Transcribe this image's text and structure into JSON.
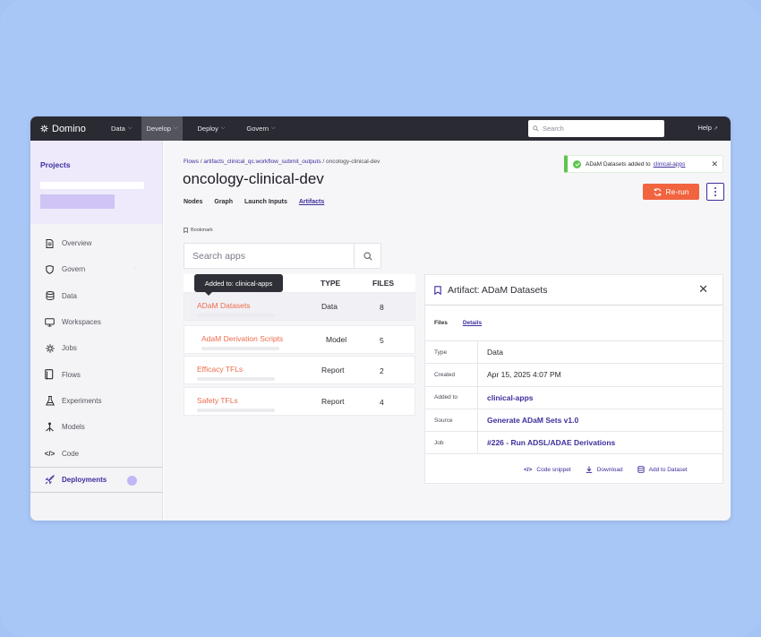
{
  "topbar": {
    "brand": "Domino",
    "nav": [
      {
        "label": "Data",
        "active": false
      },
      {
        "label": "Develop",
        "active": true
      },
      {
        "label": "Deploy",
        "active": false
      },
      {
        "label": "Govern",
        "active": false
      }
    ],
    "search_placeholder": "Search",
    "help": "Help"
  },
  "sidebar": {
    "projects_title": "Projects",
    "items": [
      {
        "label": "Overview",
        "icon": "document-icon"
      },
      {
        "label": "Govern",
        "icon": "shield-icon"
      },
      {
        "label": "Data",
        "icon": "database-icon"
      },
      {
        "label": "Workspaces",
        "icon": "monitor-icon"
      },
      {
        "label": "Jobs",
        "icon": "gear-icon"
      },
      {
        "label": "Flows",
        "icon": "flows-icon"
      },
      {
        "label": "Experiments",
        "icon": "flask-icon"
      },
      {
        "label": "Models",
        "icon": "models-icon"
      },
      {
        "label": "Code",
        "icon": "code-icon"
      },
      {
        "label": "Deployments",
        "icon": "rocket-icon",
        "active": true
      }
    ]
  },
  "main": {
    "breadcrumb": {
      "root": "Flows",
      "middle": "artifacts_clinical_qc.workflow_submit_outputs",
      "current": "oncology-clinical-dev"
    },
    "title": "oncology-clinical-dev",
    "tabs": [
      "Nodes",
      "Graph",
      "Launch Inputs",
      "Artifacts"
    ],
    "selected_tab": "Artifacts",
    "bookmark": "Bookmark",
    "search_placeholder": "Search apps",
    "table": {
      "headers": {
        "type": "TYPE",
        "files": "FILES"
      },
      "rows": [
        {
          "name": "ADaM Datasets",
          "type": "Data",
          "files": "8"
        },
        {
          "name": "AdaM Derivation Scripts",
          "type": "Model",
          "files": "5"
        },
        {
          "name": "Efficacy TFLs",
          "type": "Report",
          "files": "2"
        },
        {
          "name": "Safety TFLs",
          "type": "Report",
          "files": "4"
        }
      ]
    },
    "tooltip": "Added to: clinical-apps",
    "toast": {
      "text": "ADaM Datasets added to",
      "link": "clinical-apps"
    },
    "rerun": "Re-run"
  },
  "panel": {
    "title": "Artifact: ADaM Datasets",
    "tabs": [
      "Files",
      "Details"
    ],
    "selected_tab": "Details",
    "details": [
      {
        "key": "Type",
        "value": "Data",
        "link": false
      },
      {
        "key": "Created",
        "value": "Apr 15, 2025 4:07 PM",
        "link": false
      },
      {
        "key": "Added to",
        "value": "clinical-apps",
        "link": true
      },
      {
        "key": "Source",
        "value": "Generate ADaM Sets v1.0",
        "link": true
      },
      {
        "key": "Job",
        "value": "#226 - Run ADSL/ADAE Derivations",
        "link": true
      }
    ],
    "actions": [
      "Code snippet",
      "Download",
      "Add to Dataset"
    ]
  },
  "colors": {
    "accent": "#3c2f9d",
    "orange": "#f1643f",
    "success": "#5cc54b",
    "topbar": "#2a2a33",
    "backdrop": "#a8c6f6"
  }
}
